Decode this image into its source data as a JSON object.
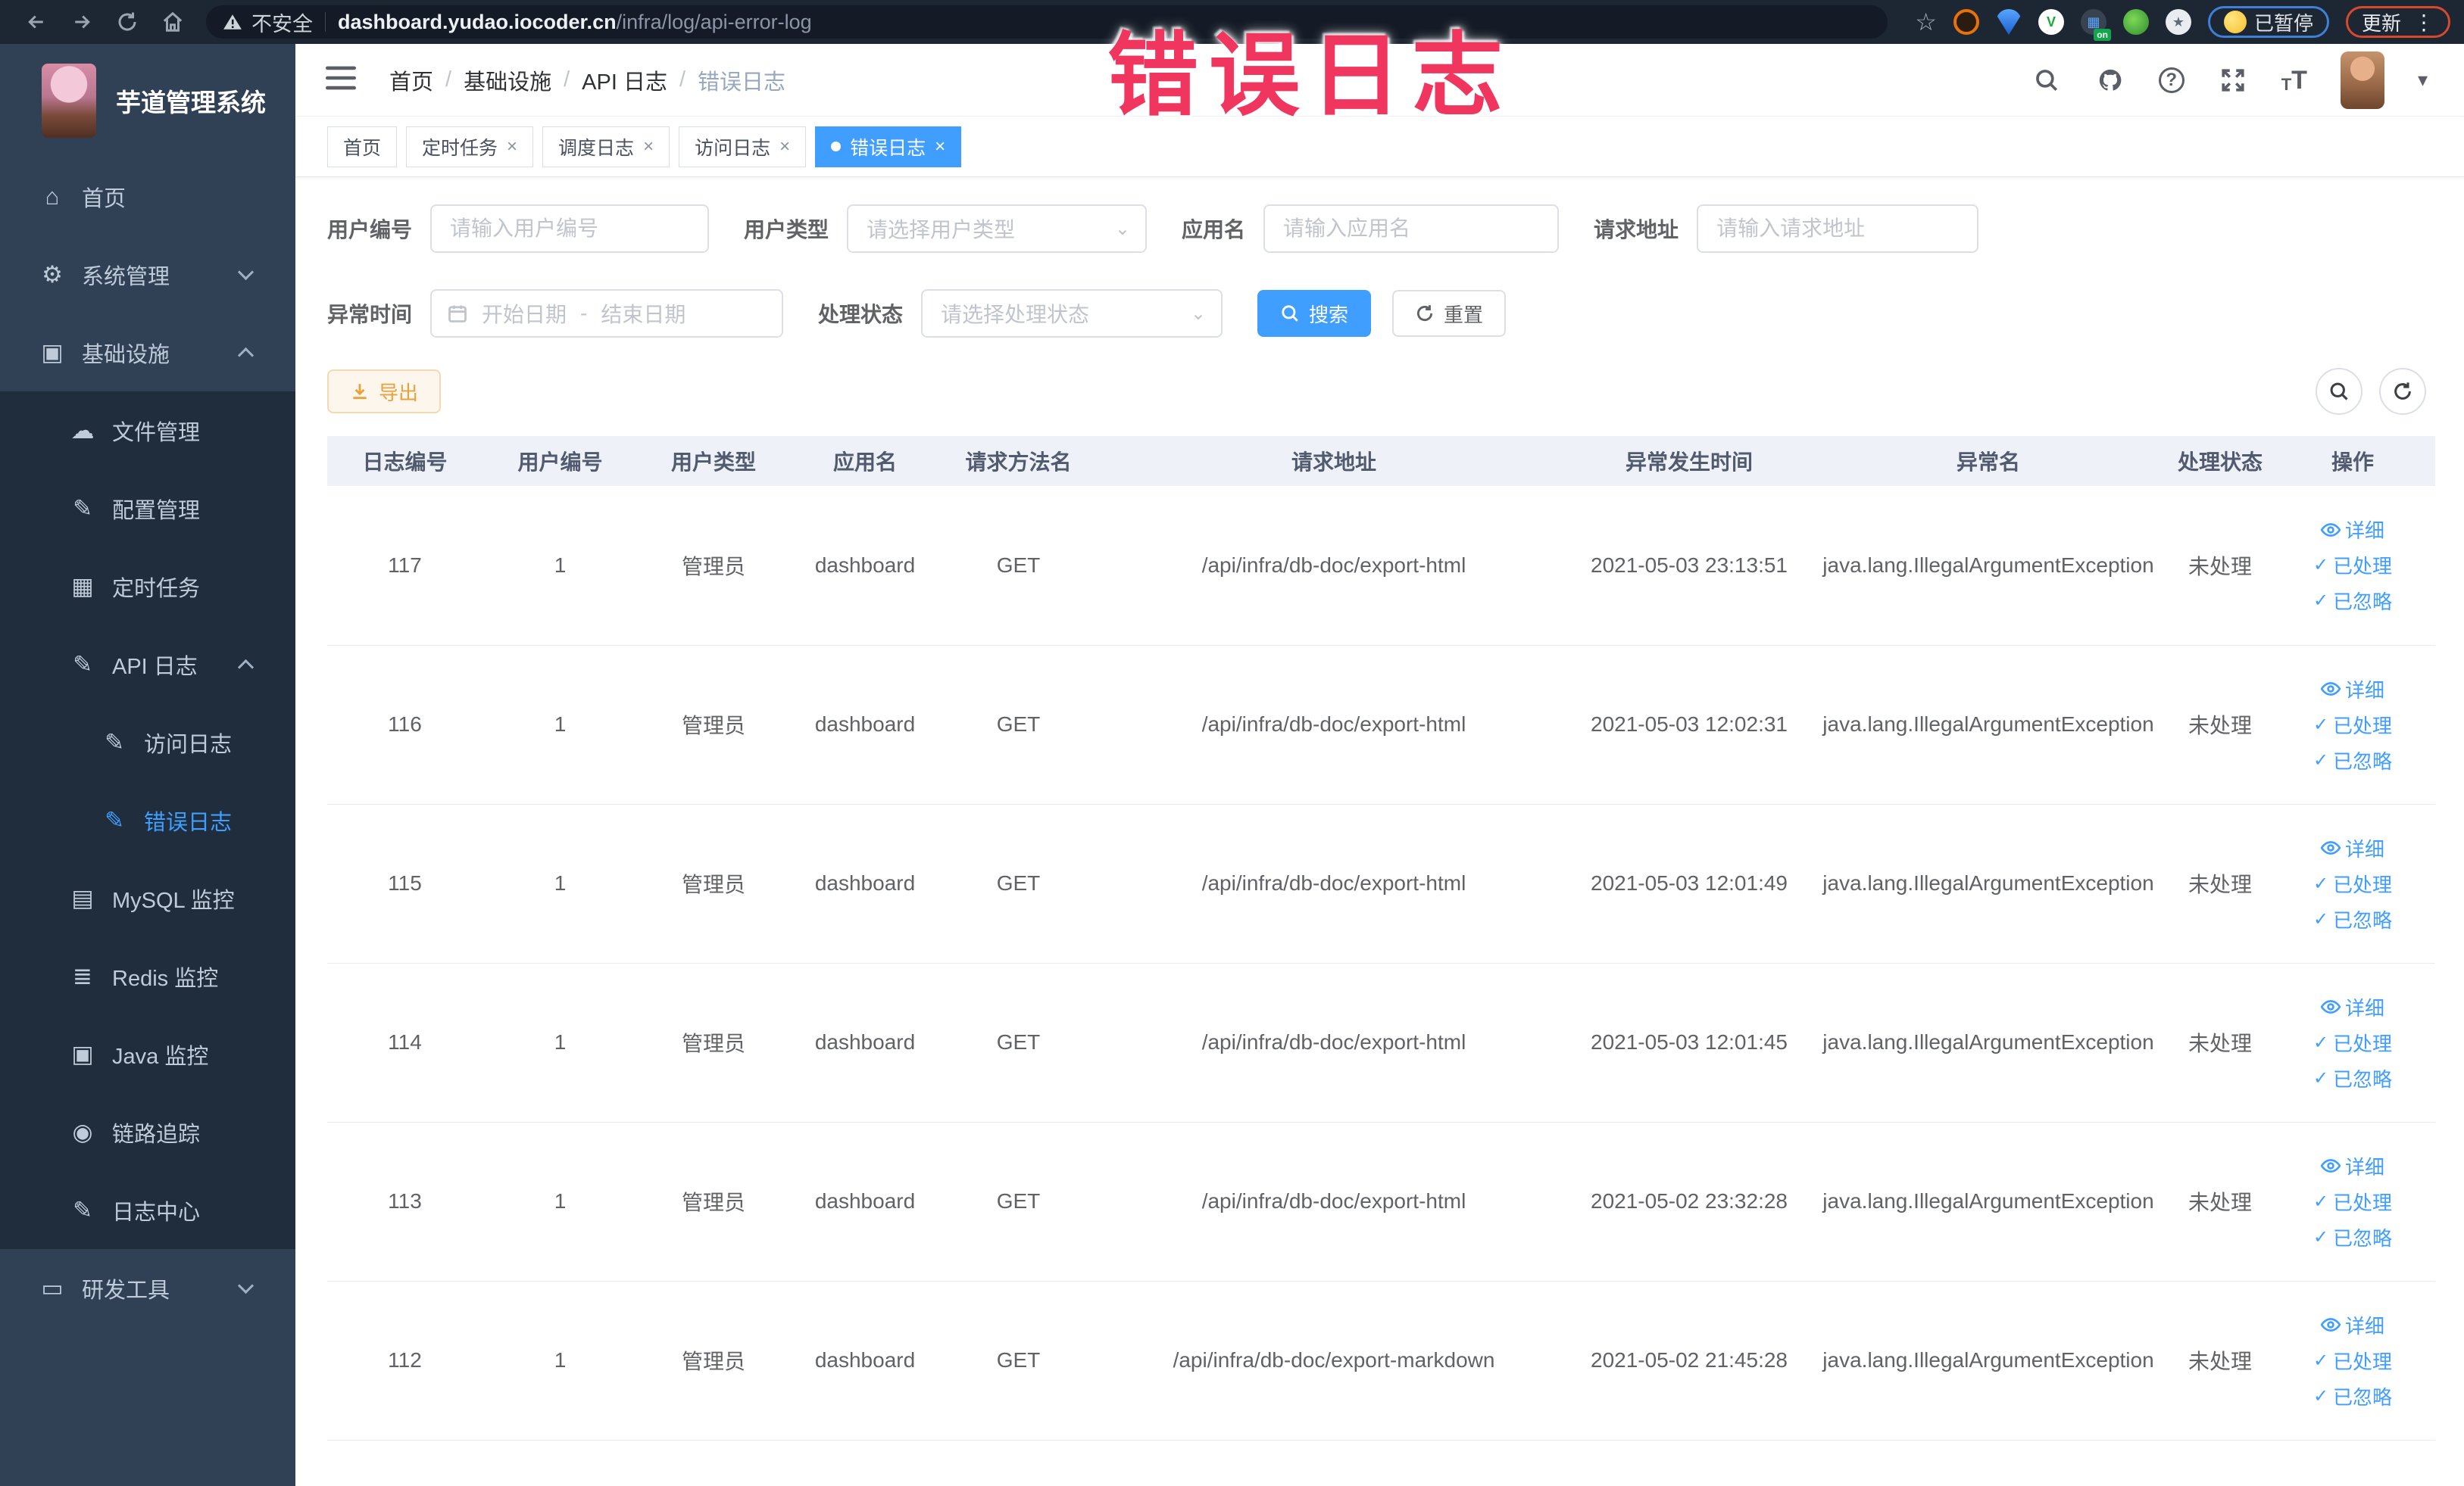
{
  "browser": {
    "security_label": "不安全",
    "url_domain": "dashboard.yudao.iocoder.cn",
    "url_path": "/infra/log/api-error-log",
    "paused_label": "已暂停",
    "update_label": "更新",
    "ext_on_badge": "on"
  },
  "annotation": "错误日志",
  "colors": {
    "accent": "#409eff",
    "warning": "#e6a23c",
    "annotation": "#f0355e",
    "sidebar_bg": "#304156",
    "submenu_bg": "#1f2d3d"
  },
  "sidebar": {
    "logo_title": "芋道管理系统",
    "items": [
      {
        "id": "home",
        "label": "首页",
        "icon": "dashboard-icon",
        "glyph": "⌂",
        "level": 0,
        "sub": false,
        "active": false,
        "chevron": null
      },
      {
        "id": "system",
        "label": "系统管理",
        "icon": "gear-icon",
        "glyph": "⚙",
        "level": 0,
        "sub": false,
        "active": false,
        "chevron": "down"
      },
      {
        "id": "infra",
        "label": "基础设施",
        "icon": "monitor-icon",
        "glyph": "▣",
        "level": 0,
        "sub": false,
        "active": false,
        "chevron": "up"
      },
      {
        "id": "file",
        "label": "文件管理",
        "icon": "cloud-upload-icon",
        "glyph": "☁",
        "level": 1,
        "sub": true,
        "active": false,
        "chevron": null
      },
      {
        "id": "config",
        "label": "配置管理",
        "icon": "edit-icon",
        "glyph": "✎",
        "level": 1,
        "sub": true,
        "active": false,
        "chevron": null
      },
      {
        "id": "job",
        "label": "定时任务",
        "icon": "task-icon",
        "glyph": "▦",
        "level": 1,
        "sub": true,
        "active": false,
        "chevron": null
      },
      {
        "id": "api-log",
        "label": "API 日志",
        "icon": "log-edit-icon",
        "glyph": "✎",
        "level": 1,
        "sub": true,
        "active": false,
        "chevron": "up"
      },
      {
        "id": "access-log",
        "label": "访问日志",
        "icon": "log-edit-icon",
        "glyph": "✎",
        "level": 2,
        "sub": true,
        "active": false,
        "chevron": null
      },
      {
        "id": "error-log",
        "label": "错误日志",
        "icon": "log-edit-icon",
        "glyph": "✎",
        "level": 2,
        "sub": true,
        "active": true,
        "chevron": null
      },
      {
        "id": "mysql",
        "label": "MySQL 监控",
        "icon": "mysql-monitor-icon",
        "glyph": "▤",
        "level": 1,
        "sub": true,
        "active": false,
        "chevron": null
      },
      {
        "id": "redis",
        "label": "Redis 监控",
        "icon": "redis-monitor-icon",
        "glyph": "≣",
        "level": 1,
        "sub": true,
        "active": false,
        "chevron": null
      },
      {
        "id": "java",
        "label": "Java 监控",
        "icon": "java-monitor-icon",
        "glyph": "▣",
        "level": 1,
        "sub": true,
        "active": false,
        "chevron": null
      },
      {
        "id": "trace",
        "label": "链路追踪",
        "icon": "eye-icon",
        "glyph": "◉",
        "level": 1,
        "sub": true,
        "active": false,
        "chevron": null
      },
      {
        "id": "log-center",
        "label": "日志中心",
        "icon": "log-edit-icon",
        "glyph": "✎",
        "level": 1,
        "sub": true,
        "active": false,
        "chevron": null
      },
      {
        "id": "dev-tools",
        "label": "研发工具",
        "icon": "toolbox-icon",
        "glyph": "▭",
        "level": 0,
        "sub": false,
        "active": false,
        "chevron": "down"
      }
    ]
  },
  "header": {
    "breadcrumb": [
      "首页",
      "基础设施",
      "API 日志",
      "错误日志"
    ]
  },
  "tabs": [
    {
      "label": "首页",
      "closable": false,
      "active": false
    },
    {
      "label": "定时任务",
      "closable": true,
      "active": false
    },
    {
      "label": "调度日志",
      "closable": true,
      "active": false
    },
    {
      "label": "访问日志",
      "closable": true,
      "active": false
    },
    {
      "label": "错误日志",
      "closable": true,
      "active": true
    }
  ],
  "filters": {
    "user_id_label": "用户编号",
    "user_id_placeholder": "请输入用户编号",
    "user_type_label": "用户类型",
    "user_type_placeholder": "请选择用户类型",
    "app_name_label": "应用名",
    "app_name_placeholder": "请输入应用名",
    "request_url_label": "请求地址",
    "request_url_placeholder": "请输入请求地址",
    "exception_time_label": "异常时间",
    "start_date_placeholder": "开始日期",
    "range_separator": "-",
    "end_date_placeholder": "结束日期",
    "process_status_label": "处理状态",
    "process_status_placeholder": "请选择处理状态",
    "search_label": "搜索",
    "reset_label": "重置"
  },
  "toolbar": {
    "export_label": "导出"
  },
  "table": {
    "columns": [
      "日志编号",
      "用户编号",
      "用户类型",
      "应用名",
      "请求方法名",
      "请求地址",
      "异常发生时间",
      "异常名",
      "处理状态",
      "操作"
    ],
    "actions": [
      "详细",
      "已处理",
      "已忽略"
    ],
    "rows": [
      {
        "id": "117",
        "user_id": "1",
        "user_type": "管理员",
        "app": "dashboard",
        "method": "GET",
        "url": "/api/infra/db-doc/export-html",
        "time": "2021-05-03 23:13:51",
        "exception": "java.lang.IllegalArgumentException",
        "status": "未处理"
      },
      {
        "id": "116",
        "user_id": "1",
        "user_type": "管理员",
        "app": "dashboard",
        "method": "GET",
        "url": "/api/infra/db-doc/export-html",
        "time": "2021-05-03 12:02:31",
        "exception": "java.lang.IllegalArgumentException",
        "status": "未处理"
      },
      {
        "id": "115",
        "user_id": "1",
        "user_type": "管理员",
        "app": "dashboard",
        "method": "GET",
        "url": "/api/infra/db-doc/export-html",
        "time": "2021-05-03 12:01:49",
        "exception": "java.lang.IllegalArgumentException",
        "status": "未处理"
      },
      {
        "id": "114",
        "user_id": "1",
        "user_type": "管理员",
        "app": "dashboard",
        "method": "GET",
        "url": "/api/infra/db-doc/export-html",
        "time": "2021-05-03 12:01:45",
        "exception": "java.lang.IllegalArgumentException",
        "status": "未处理"
      },
      {
        "id": "113",
        "user_id": "1",
        "user_type": "管理员",
        "app": "dashboard",
        "method": "GET",
        "url": "/api/infra/db-doc/export-html",
        "time": "2021-05-02 23:32:28",
        "exception": "java.lang.IllegalArgumentException",
        "status": "未处理"
      },
      {
        "id": "112",
        "user_id": "1",
        "user_type": "管理员",
        "app": "dashboard",
        "method": "GET",
        "url": "/api/infra/db-doc/export-markdown",
        "time": "2021-05-02 21:45:28",
        "exception": "java.lang.IllegalArgumentException",
        "status": "未处理"
      }
    ]
  }
}
